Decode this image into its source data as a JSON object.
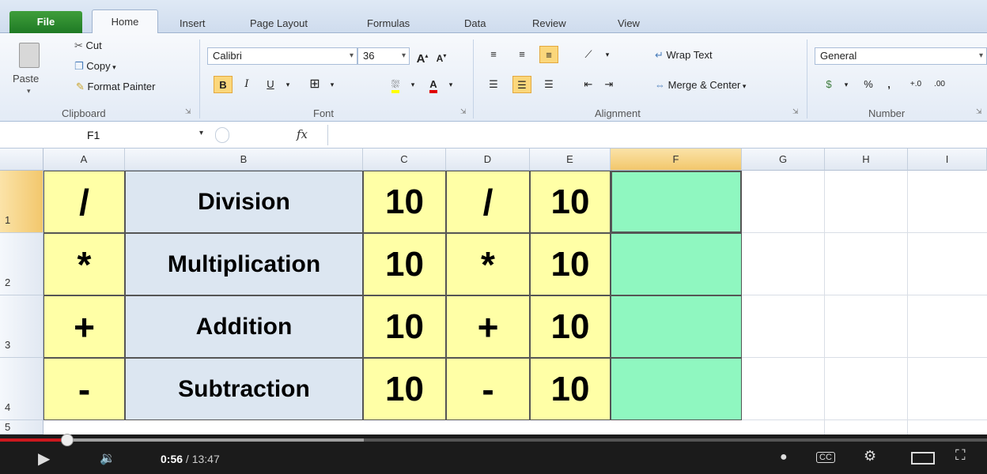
{
  "ribbon": {
    "tabs": [
      "File",
      "Home",
      "Insert",
      "Page Layout",
      "Formulas",
      "Data",
      "Review",
      "View"
    ],
    "clipboard": {
      "paste": "Paste",
      "cut": "Cut",
      "copy": "Copy",
      "format_painter": "Format Painter",
      "label": "Clipboard"
    },
    "font": {
      "name": "Calibri",
      "size": "36",
      "label": "Font"
    },
    "alignment": {
      "wrap_text": "Wrap Text",
      "merge_center": "Merge & Center",
      "label": "Alignment"
    },
    "number": {
      "format": "General",
      "percent": "%",
      "comma": ",",
      "label": "Number"
    }
  },
  "formula_bar": {
    "name_box": "F1",
    "fx": "fx",
    "content": ""
  },
  "sheet": {
    "columns": [
      "A",
      "B",
      "C",
      "D",
      "E",
      "F",
      "G",
      "H",
      "I"
    ],
    "rows": [
      "1",
      "2",
      "3",
      "4",
      "5"
    ],
    "selected_column": "F",
    "selected_row": "1",
    "data": [
      [
        "/",
        "Division",
        "10",
        "/",
        "10"
      ],
      [
        "*",
        "Multiplication",
        "10",
        "*",
        "10"
      ],
      [
        "+",
        "Addition",
        "10",
        "+",
        "10"
      ],
      [
        "-",
        "Subtraction",
        "10",
        "-",
        "10"
      ]
    ]
  },
  "player": {
    "current_time": "0:56",
    "total_time": "13:47",
    "progress": 0.068,
    "accent_color": "#cc181e"
  }
}
